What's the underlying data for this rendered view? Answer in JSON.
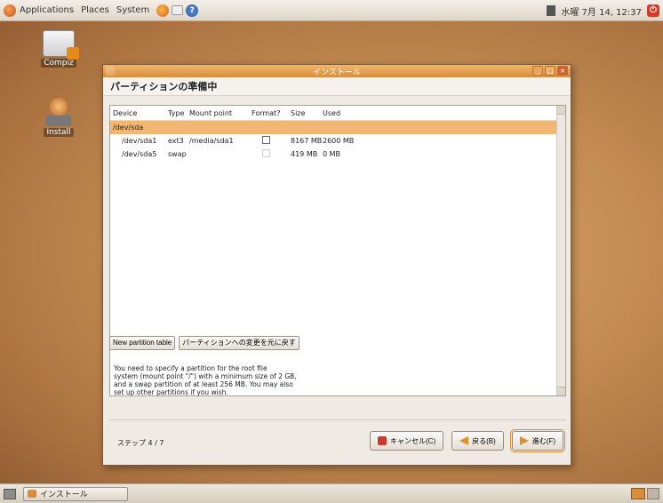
{
  "top_panel": {
    "menus": [
      "Applications",
      "Places",
      "System"
    ],
    "clock": "水曜 7月 14, 12:37",
    "icons": [
      "ubuntu-logo-icon",
      "firefox-icon",
      "mail-icon",
      "help-icon",
      "network-icon",
      "power-icon"
    ]
  },
  "desktop": {
    "icons": [
      {
        "label": "Compiz",
        "icon": "folder-icon"
      },
      {
        "label": "Install",
        "icon": "installer-icon"
      }
    ]
  },
  "window": {
    "title": "インストール",
    "heading": "パーティションの準備中",
    "table": {
      "columns": [
        "Device",
        "Type",
        "Mount point",
        "Format?",
        "Size",
        "Used"
      ],
      "rows": [
        {
          "device": "/dev/sda",
          "type": "",
          "mount": "",
          "format": null,
          "size": "",
          "used": "",
          "selected": true
        },
        {
          "device": "/dev/sda1",
          "type": "ext3",
          "mount": "/media/sda1",
          "format": false,
          "size": "8167 MB",
          "used": "2600 MB",
          "selected": false
        },
        {
          "device": "/dev/sda5",
          "type": "swap",
          "mount": "",
          "format": false,
          "size": "419 MB",
          "used": "0 MB",
          "selected": false
        }
      ]
    },
    "buttons": {
      "new_table": "New partition table",
      "revert": "パーティションへの変更を元に戻す"
    },
    "info": "You need to specify a partition for the root file\nsystem (mount point \"/\") with a minimum size of 2 GB,\nand a swap partition of at least 256 MB. You may also\nset up other partitions if you wish.",
    "step": "ステップ 4 / 7",
    "nav": {
      "cancel": "キャンセル(C)",
      "back": "戻る(B)",
      "forward": "進む(F)"
    }
  },
  "bottom_panel": {
    "task": "インストール"
  }
}
